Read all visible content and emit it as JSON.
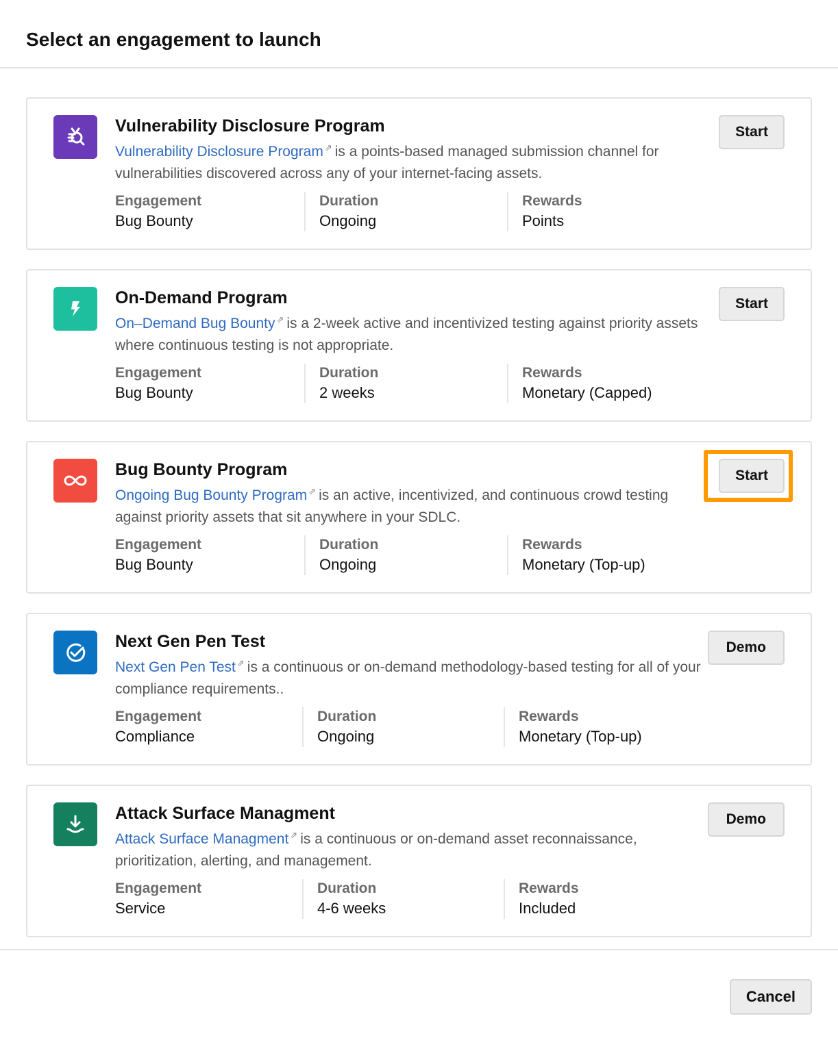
{
  "header": {
    "title": "Select an engagement to launch"
  },
  "labels": {
    "engagement": "Engagement",
    "duration": "Duration",
    "rewards": "Rewards",
    "external_link_icon": "⇗"
  },
  "cards": [
    {
      "title": "Vulnerability Disclosure Program",
      "link_text": "Vulnerability Disclosure Program",
      "description": "is a points-based managed submission channel for vulnerabilities discovered across any of your internet-facing assets.",
      "engagement": "Bug Bounty",
      "duration": "Ongoing",
      "rewards": "Points",
      "button": "Start",
      "icon": "bug-search-icon",
      "icon_color": "#6a3ab8"
    },
    {
      "title": "On-Demand Program",
      "link_text": "On–Demand Bug Bounty",
      "description": "is a 2-week active and incentivized testing against priority assets where continuous testing is not appropriate.",
      "engagement": "Bug Bounty",
      "duration": "2 weeks",
      "rewards": "Monetary (Capped)",
      "button": "Start",
      "icon": "lightning-icon",
      "icon_color": "#1dbf9f"
    },
    {
      "title": "Bug Bounty Program",
      "link_text": "Ongoing Bug Bounty Program",
      "description": "is an active, incentivized, and continuous crowd testing against priority assets that sit anywhere in your SDLC.",
      "engagement": "Bug Bounty",
      "duration": "Ongoing",
      "rewards": "Monetary (Top-up)",
      "button": "Start",
      "icon": "infinity-icon",
      "icon_color": "#f24b3f",
      "highlighted": true
    },
    {
      "title": "Next Gen Pen Test",
      "link_text": "Next Gen Pen Test",
      "description": "is a continuous or on-demand methodology-based testing for all of your compliance requirements..",
      "engagement": "Compliance",
      "duration": "Ongoing",
      "rewards": "Monetary (Top-up)",
      "button": "Demo",
      "icon": "check-circle-icon",
      "icon_color": "#0b74c2"
    },
    {
      "title": "Attack Surface Managment",
      "link_text": "Attack Surface Managment",
      "description": "is a continuous or on-demand asset reconnaissance, prioritization, alerting, and management.",
      "engagement": "Service",
      "duration": "4-6 weeks",
      "rewards": "Included",
      "button": "Demo",
      "icon": "download-icon",
      "icon_color": "#14805e"
    }
  ],
  "colors": {
    "highlight": "#ff9a00",
    "link": "#2f6bc1"
  },
  "footer": {
    "cancel_label": "Cancel"
  }
}
